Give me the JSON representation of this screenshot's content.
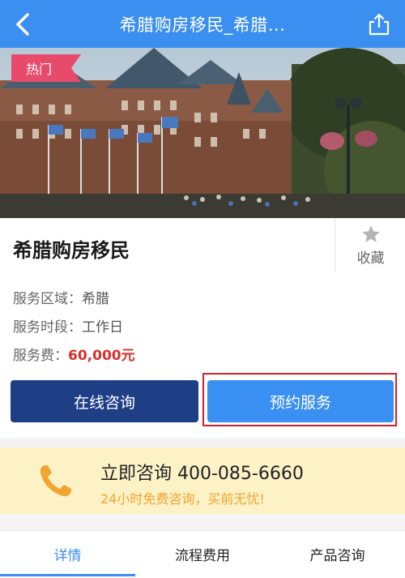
{
  "header": {
    "title": "希腊购房移民_希腊...",
    "back_icon": "back-chevron-icon",
    "share_icon": "share-icon",
    "bg_color": "#3b8ff0"
  },
  "hero": {
    "tag": "热门",
    "tag_color": "#e84a6c"
  },
  "product": {
    "title": "希腊购房移民",
    "favorite_label": "收藏",
    "favorite_icon": "star-icon",
    "service_area_label": "服务区域：",
    "service_area_value": "希腊",
    "service_time_label": "服务时段：",
    "service_time_value": "工作日",
    "fee_label": "服务费：",
    "fee_value": "60,000元",
    "price_color": "#d8302b"
  },
  "actions": {
    "consult_label": "在线咨询",
    "book_label": "预约服务",
    "consult_color": "#1e3f86",
    "book_color": "#3a8ff3"
  },
  "hotline": {
    "main": "立即咨询 400-085-6660",
    "sub": "24小时免费咨询，买前无忧!",
    "icon": "phone-icon",
    "bg_color": "#fdf1c6"
  },
  "tabs": {
    "items": [
      {
        "label": "详情",
        "active": true
      },
      {
        "label": "流程费用",
        "active": false
      },
      {
        "label": "产品咨询",
        "active": false
      }
    ]
  }
}
